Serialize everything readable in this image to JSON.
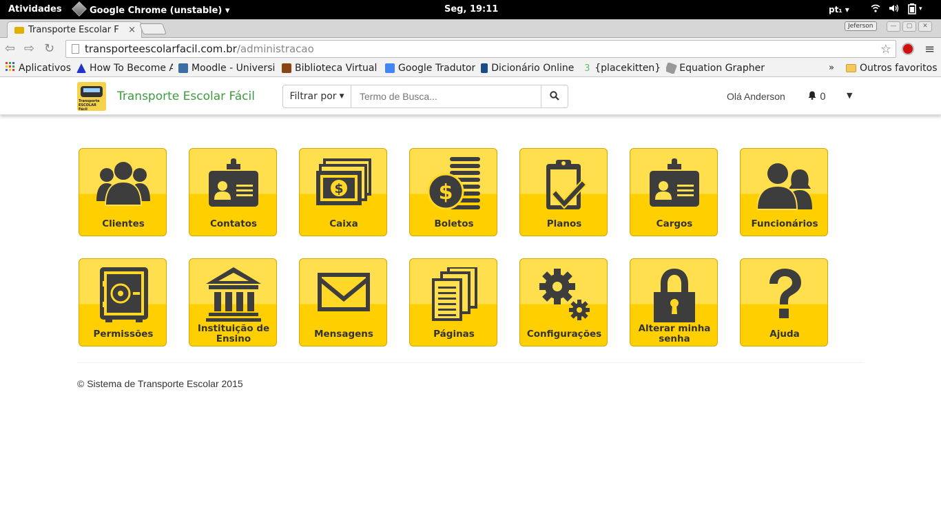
{
  "os_bar": {
    "activities": "Atividades",
    "app_menu": "Google Chrome (unstable) ▾",
    "clock": "Seg, 19:11",
    "lang": "pt₁ ▾"
  },
  "browser": {
    "tab_title": "Transporte Escolar F",
    "profile": "Jeferson",
    "url_host": "transporteescolarfacil.com.br",
    "url_path": "/administracao",
    "bookmarks": [
      {
        "label": "Aplicativos",
        "color": "#4a8"
      },
      {
        "label": "How To Become A",
        "color": "#2233cc"
      },
      {
        "label": "Moodle - Universi",
        "color": "#3a6ea5"
      },
      {
        "label": "Biblioteca Virtual",
        "color": "#8b4513"
      },
      {
        "label": "Google Tradutor",
        "color": "#4285f4"
      },
      {
        "label": "Dicionário Online",
        "color": "#1a4c8b"
      },
      {
        "label": "{placekitten}",
        "color": "#6b6"
      },
      {
        "label": "Equation Grapher",
        "color": "#777"
      }
    ],
    "bookmarks_more": "»",
    "other_bookmarks": "Outros favoritos"
  },
  "site": {
    "brand": "Transporte Escolar Fácil",
    "logo_text_1": "Transporte",
    "logo_text_2": "ESCOLAR Fácil",
    "filter_label": "Filtrar por",
    "search_placeholder": "Termo de Busca...",
    "greeting": "Olá Anderson",
    "notif_count": "0"
  },
  "tiles": [
    {
      "label": "Clientes",
      "icon": "users-icon"
    },
    {
      "label": "Contatos",
      "icon": "id-card-icon"
    },
    {
      "label": "Caixa",
      "icon": "money-icon"
    },
    {
      "label": "Boletos",
      "icon": "coins-icon"
    },
    {
      "label": "Planos",
      "icon": "clipboard-check-icon"
    },
    {
      "label": "Cargos",
      "icon": "id-card-icon"
    },
    {
      "label": "Funcionários",
      "icon": "employees-icon"
    },
    {
      "label": "Permissões",
      "icon": "safe-icon"
    },
    {
      "label": "Instituição de Ensino",
      "icon": "institution-icon"
    },
    {
      "label": "Mensagens",
      "icon": "envelope-icon"
    },
    {
      "label": "Páginas",
      "icon": "pages-icon"
    },
    {
      "label": "Configurações",
      "icon": "gears-icon"
    },
    {
      "label": "Alterar minha senha",
      "icon": "lock-icon"
    },
    {
      "label": "Ajuda",
      "icon": "question-icon"
    }
  ],
  "footer": "© Sistema de Transporte Escolar 2015",
  "colors": {
    "tile_top": "#ffdf4d",
    "tile_bottom": "#ffcf00",
    "icon": "#3d3d3d",
    "brand": "#3c9b3c"
  }
}
